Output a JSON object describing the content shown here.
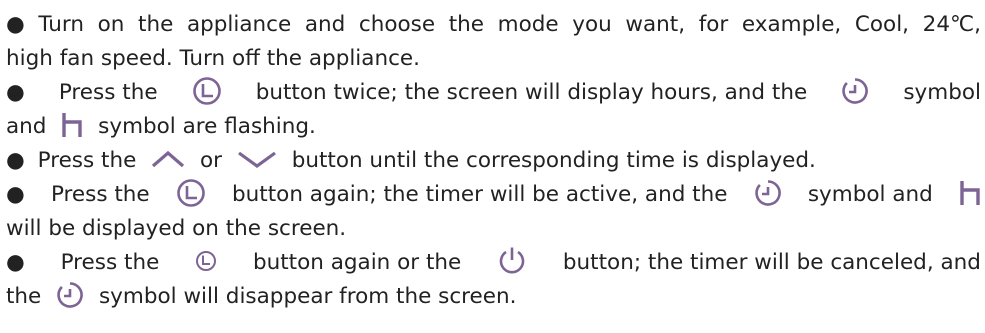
{
  "instructions": {
    "bullet": "●",
    "step1": {
      "line1": [
        "Turn",
        "on",
        "the",
        "appliance",
        "and",
        "choose",
        "the",
        "mode",
        "you",
        "want,",
        "for",
        "example,",
        "Cool,",
        "24℃,"
      ],
      "line2": "high fan speed. Turn off the appliance."
    },
    "step2": {
      "l1_a": "Press the",
      "l1_b": "button twice; the screen will display hours, and the",
      "l1_c": "symbol",
      "l2_a": "and",
      "l2_b": "symbol are flashing."
    },
    "step3": {
      "a": "Press the",
      "b": "or",
      "c": "button until the corresponding time is displayed."
    },
    "step4": {
      "l1_a": "Press the",
      "l1_b": "button again; the timer will be active, and the",
      "l1_c": "symbol and",
      "l2": "will be displayed on the screen."
    },
    "step5": {
      "l1_a": "Press the",
      "l1_b": "button again or the",
      "l1_c": "button; the timer will be canceled, and",
      "l2_a": "the",
      "l2_b": "symbol will disappear from the screen."
    }
  },
  "icons": {
    "timer_button": "timer-button-icon",
    "timer_symbol": "timer-symbol-icon",
    "hour_symbol": "hour-symbol-icon",
    "up_arrow": "up-arrow-icon",
    "down_arrow": "down-arrow-icon",
    "power_button": "power-icon",
    "icon_color": "#7d6495"
  }
}
